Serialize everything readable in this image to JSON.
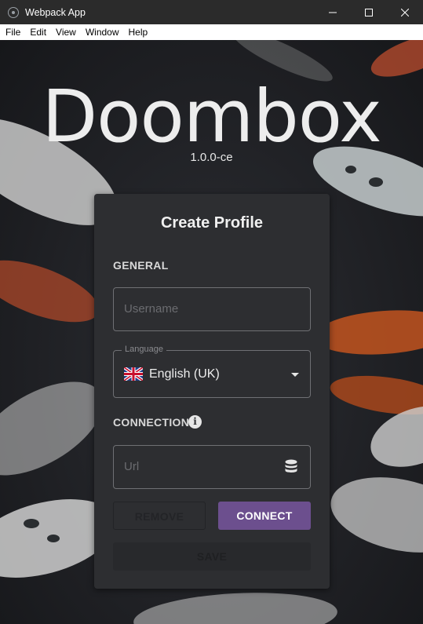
{
  "window": {
    "title": "Webpack App",
    "controls": [
      "minimize",
      "maximize",
      "close"
    ]
  },
  "menu": {
    "items": [
      "File",
      "Edit",
      "View",
      "Window",
      "Help"
    ]
  },
  "brand": {
    "name": "Doombox",
    "version": "1.0.0-ce"
  },
  "form": {
    "title": "Create Profile",
    "general_label": "GENERAL",
    "username_placeholder": "Username",
    "language": {
      "legend": "Language",
      "value": "English (UK)",
      "flag_icon": "uk-flag-icon"
    },
    "connection_label": "CONNECTION",
    "url_placeholder": "Url",
    "buttons": {
      "remove": "REMOVE",
      "connect": "CONNECT",
      "save": "SAVE"
    }
  },
  "colors": {
    "accent": "#6c4f8e",
    "card": "#2d2e31"
  }
}
